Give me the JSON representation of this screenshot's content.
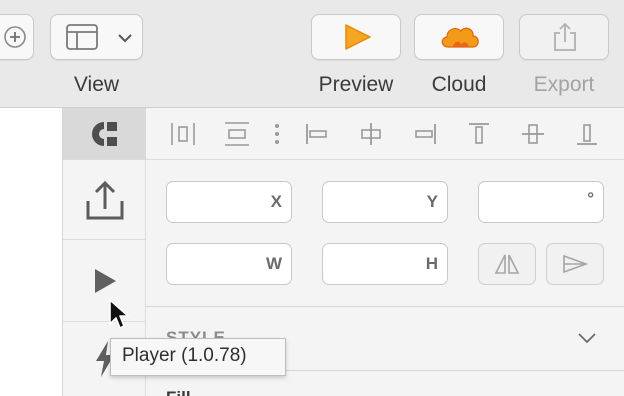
{
  "toolbar": {
    "view_label": "View",
    "preview_label": "Preview",
    "cloud_label": "Cloud",
    "export_label": "Export",
    "colors": {
      "preview_icon": "#f5a623",
      "cloud_icon": "#f07f16",
      "export_disabled": "#a3a3a3"
    }
  },
  "inspector": {
    "fields": {
      "x_label": "X",
      "y_label": "Y",
      "rotation_label": "°",
      "w_label": "W",
      "h_label": "H"
    },
    "style_section": "STYLE",
    "fill_section": "Fill"
  },
  "tabs": [
    "code-icon",
    "share-icon",
    "play-icon",
    "bolt-icon"
  ],
  "tooltip": {
    "text": "Player (1.0.78)"
  }
}
